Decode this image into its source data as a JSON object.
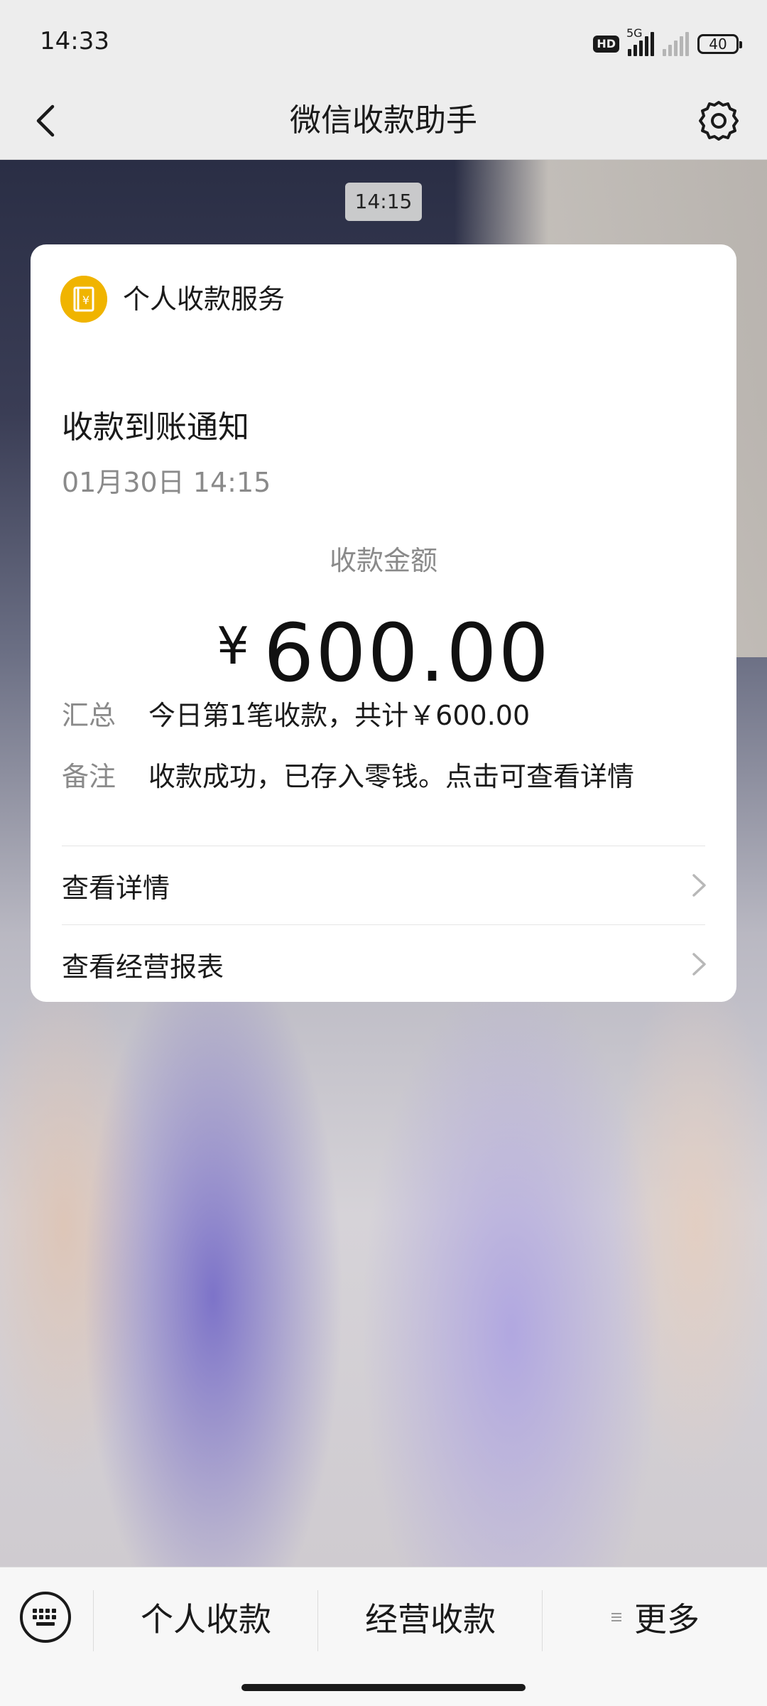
{
  "status_bar": {
    "time": "14:33",
    "hd_badge": "HD",
    "network_label": "5G",
    "battery": "40",
    "icons": [
      "signal-icon",
      "signal-weak-icon",
      "battery-icon"
    ]
  },
  "nav": {
    "title": "微信收款助手",
    "back_icon": "chevron-left-icon",
    "settings_icon": "gear-icon"
  },
  "chat": {
    "time_chip": "14:15",
    "card": {
      "service_name": "个人收款服务",
      "service_icon": "wallet-yen-icon",
      "service_icon_glyph": "¥",
      "service_icon_color": "#f0b400",
      "notice_title": "收款到账通知",
      "notice_time": "01月30日 14:15",
      "amount_label": "收款金额",
      "amount_currency": "¥",
      "amount_value": "600.00",
      "summary_label": "汇总",
      "summary_value": "今日第1笔收款，共计￥600.00",
      "note_label": "备注",
      "note_value": "收款成功，已存入零钱。点击可查看详情",
      "links": [
        {
          "label": "查看详情",
          "icon": "chevron-right-icon"
        },
        {
          "label": "查看经营报表",
          "icon": "chevron-right-icon"
        }
      ]
    }
  },
  "bottom_menu": {
    "keyboard_icon": "keyboard-icon",
    "tabs": [
      {
        "label": "个人收款"
      },
      {
        "label": "经营收款"
      },
      {
        "label": "更多",
        "icon": "menu-lines-icon"
      }
    ]
  }
}
